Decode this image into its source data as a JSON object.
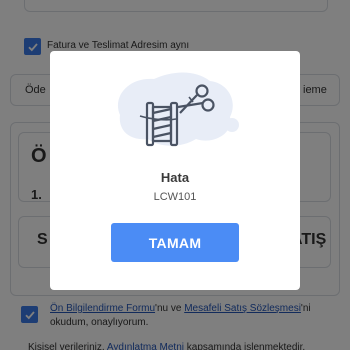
{
  "background": {
    "billing_checkbox_label": "Fatura ve Teslimat Adresim aynı",
    "payment_row_left": "Öde",
    "payment_row_right": "ieme",
    "heading_fragment": "Ö",
    "step_fragment": "1.",
    "table_left_fragment": "S",
    "table_right_fragment": "ATIŞ",
    "agreement": {
      "link1": "Ön Bilgilendirme Formu",
      "text1": "'nu ve ",
      "link2": "Mesafeli Satış Sözleşmesi",
      "text2": "'ni",
      "line2": "okudum, onaylıyorum."
    },
    "kvkk": {
      "text1": "Kişisel verileriniz, ",
      "link": "Aydınlatma Metni",
      "text2": " kapsamında işlenmektedir."
    }
  },
  "modal": {
    "illustration_icon": "thread-and-scissors-icon",
    "title": "Hata",
    "code": "LCW101",
    "ok_label": "TAMAM"
  },
  "colors": {
    "accent": "#3b7be8",
    "button": "#4b8cf5",
    "overlay": "rgba(0,0,0,0.5)"
  }
}
